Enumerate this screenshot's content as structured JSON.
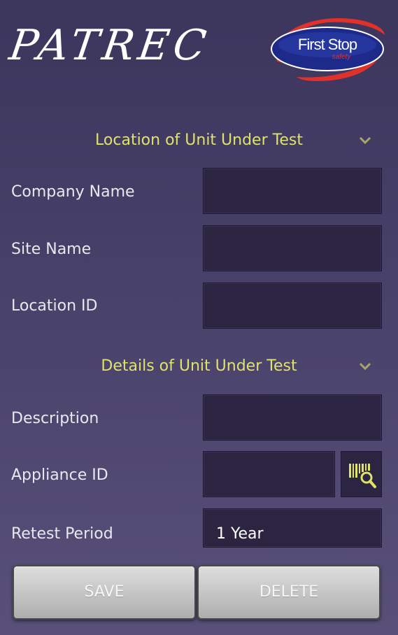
{
  "header": {
    "app_title": "PATREC",
    "logo_text_main": "First Stop",
    "logo_text_sub": "safety"
  },
  "sections": {
    "location": {
      "title": "Location of Unit Under Test",
      "icon": "chevron-down-icon"
    },
    "details": {
      "title": "Details of Unit Under Test",
      "icon": "chevron-down-icon"
    }
  },
  "fields": {
    "company_name": {
      "label": "Company Name",
      "value": ""
    },
    "site_name": {
      "label": "Site Name",
      "value": ""
    },
    "location_id": {
      "label": "Location ID",
      "value": ""
    },
    "description": {
      "label": "Description",
      "value": ""
    },
    "appliance_id": {
      "label": "Appliance ID",
      "value": "",
      "action_icon": "barcode-scan-icon"
    },
    "retest_period": {
      "label": "Retest Period",
      "value": "1 Year"
    }
  },
  "buttons": {
    "save": "SAVE",
    "delete": "DELETE"
  },
  "colors": {
    "accent": "#dfe36a",
    "input_bg": "#2b2542",
    "logo_blue": "#1f2a8c",
    "logo_red": "#e0312a"
  }
}
